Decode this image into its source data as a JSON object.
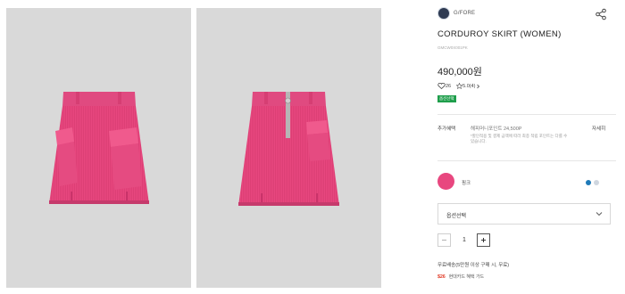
{
  "gallery": {
    "images": [
      {
        "name": "skirt-front-image",
        "icon": "pink-corduroy-skirt-front"
      },
      {
        "name": "skirt-back-image",
        "icon": "pink-corduroy-skirt-back"
      }
    ]
  },
  "product": {
    "brand": "G/FORE",
    "title": "CORDUROY SKIRT (WOMEN)",
    "code": "GMCW0X001PK",
    "price": "490,000원",
    "likes": "26",
    "rating": "5.0(4)",
    "badge": "옵션선택"
  },
  "benefit": {
    "label": "추가혜택",
    "points": "해피머니포인트 24,500P",
    "detail_link": "자세히",
    "note": "*할인적용 및 결제 금액에 따라 최종 적립 포인트는 다를 수 있습니다."
  },
  "color_option": {
    "name": "핑크",
    "swatch": "#e8477f",
    "dots": [
      "#1f7ab8",
      "#cfd6df"
    ]
  },
  "option_select": {
    "label": "옵션선택"
  },
  "quantity": {
    "value": "1",
    "minus": "−",
    "plus": "+"
  },
  "shipping": {
    "text": "무료배송(5만원 이상 구매 시, 무료)"
  },
  "payment": {
    "logo": "$26",
    "text": "현대카드 혜택 가드"
  },
  "colors": {
    "pink": "#e8477f",
    "badge_green": "#1e9e4b",
    "image_bg": "#d9d9d9"
  }
}
